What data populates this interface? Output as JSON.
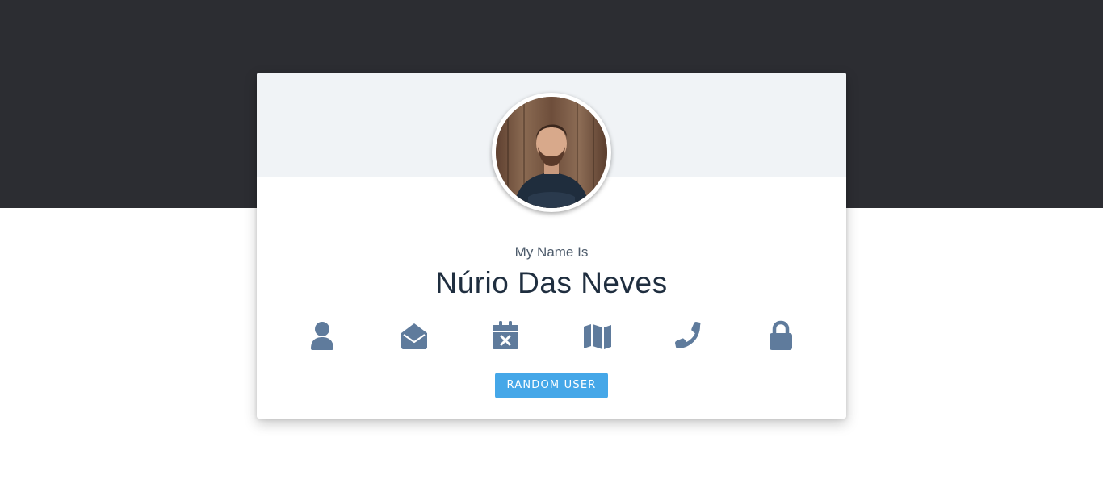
{
  "profile": {
    "label": "My Name Is",
    "value": "Núrio Das Neves"
  },
  "icons": [
    {
      "name": "user-icon",
      "color": "#5f7b9c"
    },
    {
      "name": "envelope-open-icon",
      "color": "#5f7b9c"
    },
    {
      "name": "calendar-times-icon",
      "color": "#5f7b9c"
    },
    {
      "name": "map-icon",
      "color": "#5f7b9c"
    },
    {
      "name": "phone-icon",
      "color": "#5f7b9c"
    },
    {
      "name": "lock-icon",
      "color": "#5f7b9c"
    }
  ],
  "actions": {
    "random_user_label": "RANDOM USER"
  },
  "colors": {
    "top_band": "#2c2d32",
    "card_header": "#f0f3f6",
    "accent": "#45a7e8",
    "icon": "#5f7b9c",
    "name_text": "#1f2e3f"
  }
}
